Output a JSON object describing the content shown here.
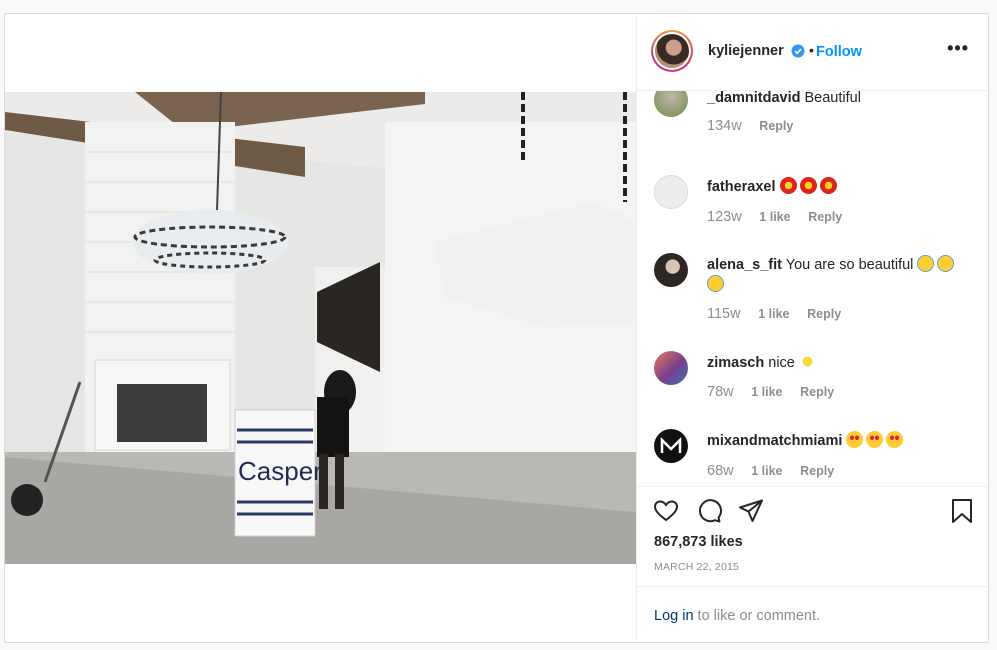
{
  "header": {
    "username": "kyliejenner",
    "separator": "•",
    "follow_label": "Follow",
    "more_label": "•••"
  },
  "photo": {
    "box_brand": "Casper"
  },
  "comments": [
    {
      "user": "_damnitdavid",
      "text": "Beautiful",
      "time": "134w",
      "likes": "",
      "reply": "Reply"
    },
    {
      "user": "fatheraxel",
      "text": "",
      "emoji": [
        "collision-emoji",
        "collision-emoji",
        "collision-emoji"
      ],
      "time": "123w",
      "likes": "1 like",
      "reply": "Reply"
    },
    {
      "user": "alena_s_fit",
      "text": "You are so beautiful",
      "emoji": [
        "smiling-halo-emoji",
        "smiling-halo-emoji",
        "smiling-halo-emoji"
      ],
      "time": "115w",
      "likes": "1 like",
      "reply": "Reply"
    },
    {
      "user": "zimasch",
      "text": "nice",
      "emoji": [
        "sparkles-emoji"
      ],
      "time": "78w",
      "likes": "1 like",
      "reply": "Reply"
    },
    {
      "user": "mixandmatchmiami",
      "text": "",
      "emoji": [
        "heart-eyes-emoji",
        "heart-eyes-emoji",
        "heart-eyes-emoji"
      ],
      "time": "68w",
      "likes": "1 like",
      "reply": "Reply"
    }
  ],
  "actions": {
    "icons": [
      "heart-icon",
      "comment-icon",
      "share-icon",
      "bookmark-icon"
    ],
    "likes_count": "867,873 likes",
    "date": "MARCH 22, 2015"
  },
  "login": {
    "link_label": "Log in",
    "rest_label": "to like or comment."
  },
  "colors": {
    "follow": "#0095f6",
    "verified": "#3897f0",
    "muted": "#8e8e8e"
  }
}
